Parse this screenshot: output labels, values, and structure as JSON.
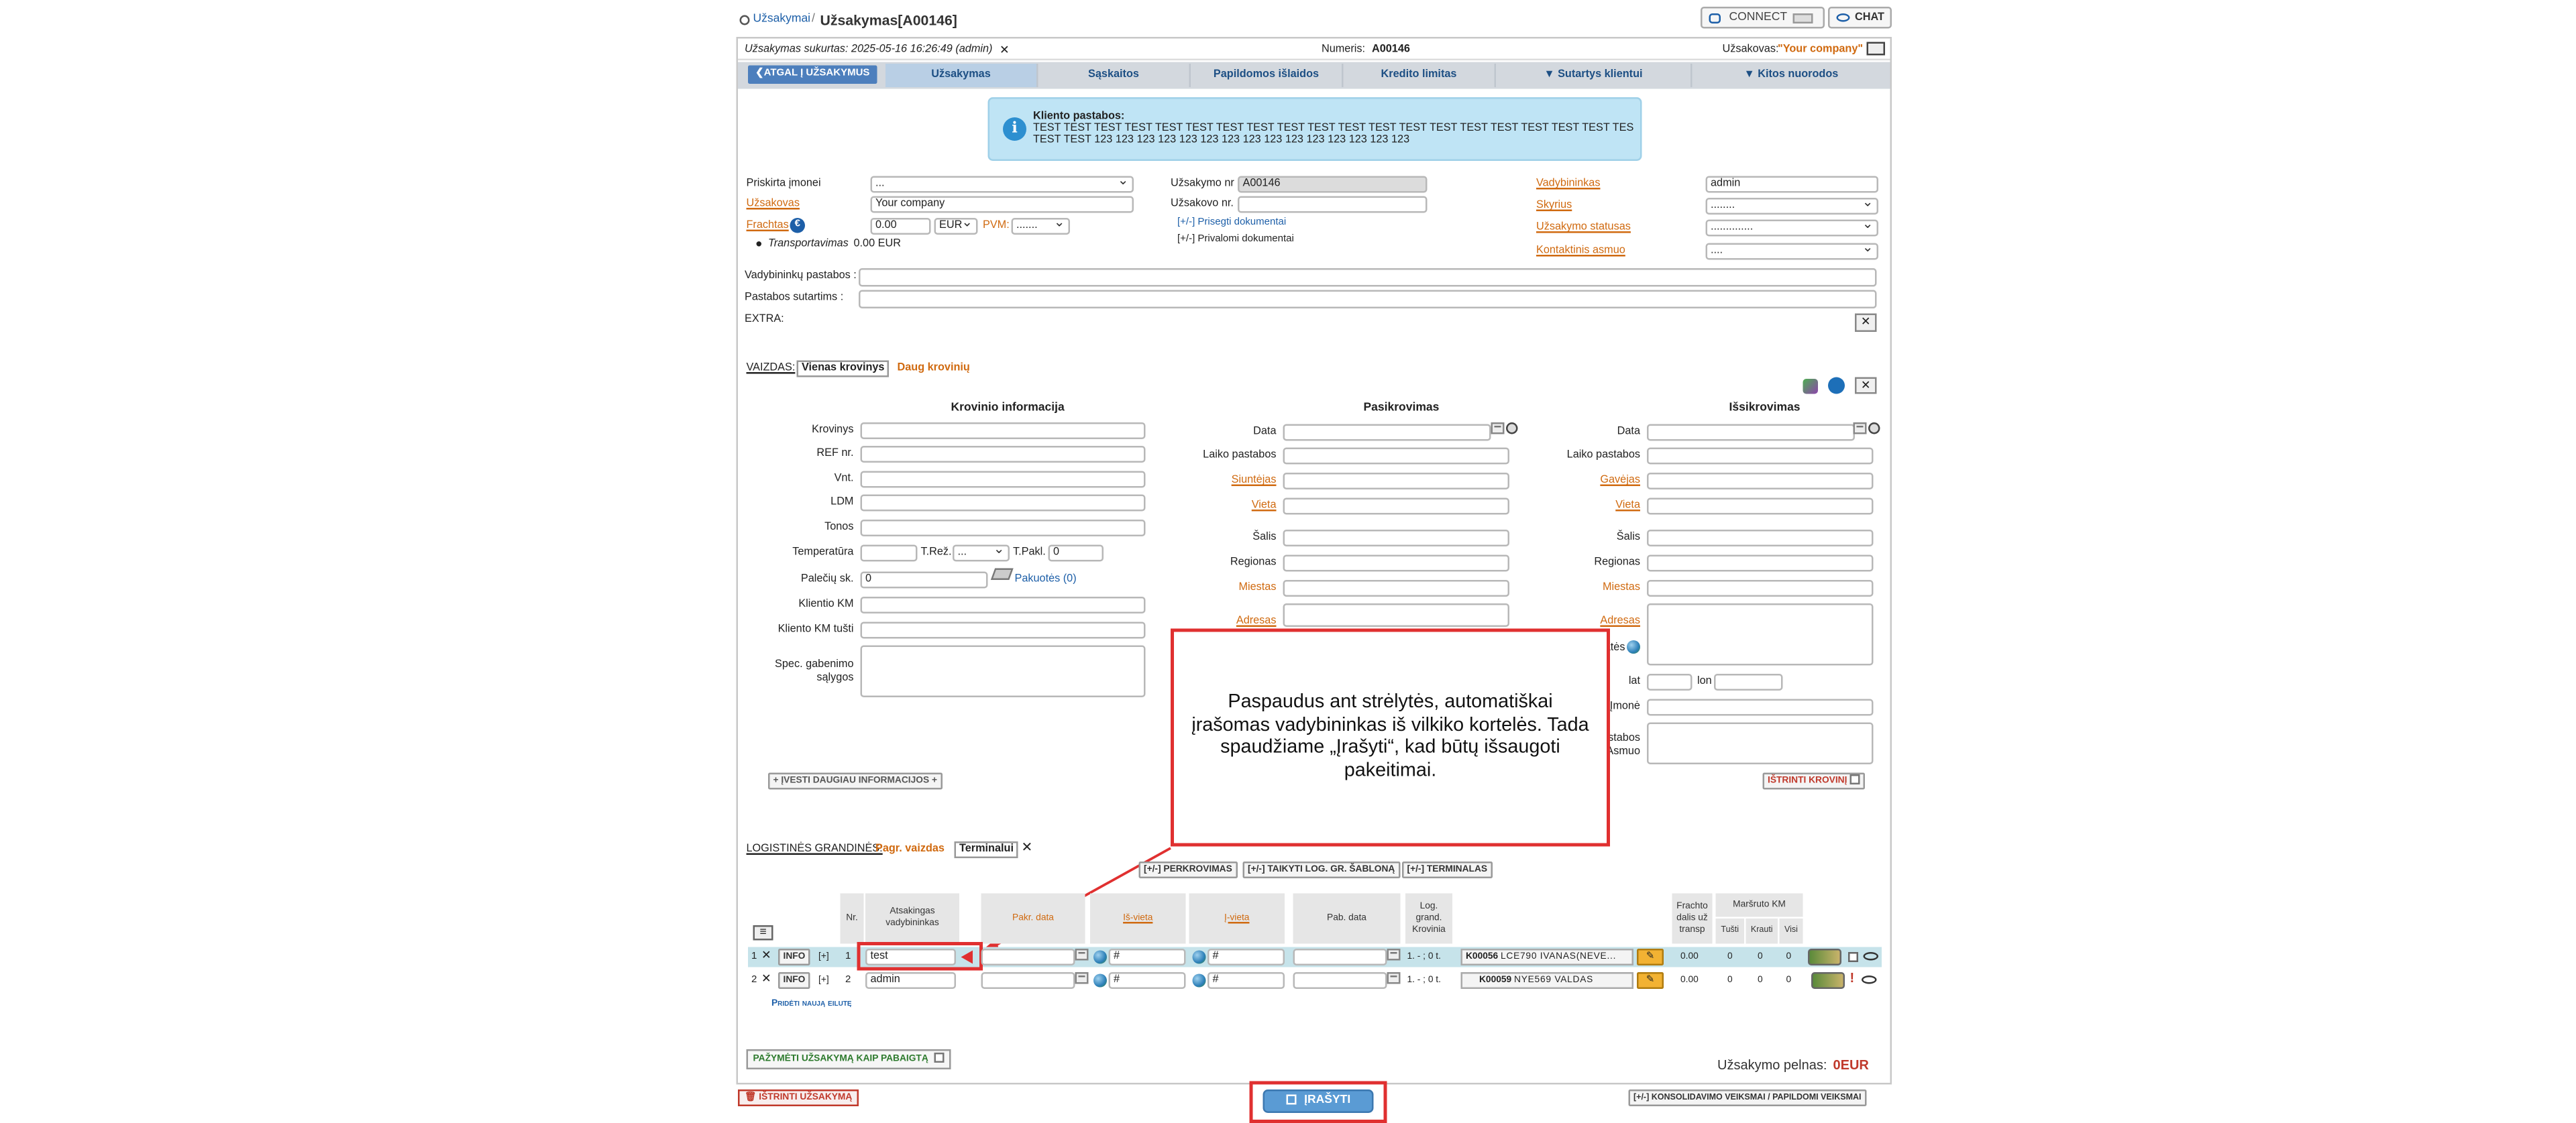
{
  "breadcrumb": {
    "parent": "Užsakymai",
    "separator": "/",
    "title": "Užsakymas[A00146]"
  },
  "top_buttons": {
    "connect": "CONNECT",
    "chat": "CHAT"
  },
  "infobar": {
    "created": "Užsakymas sukurtas: 2025-05-16 16:26:49 (admin)",
    "number_label": "Numeris:",
    "number": "A00146",
    "client_label": "Užsakovas:",
    "client": "\"Your company\""
  },
  "tabs": {
    "back": "❮ATGAL Į UŽSAKYMUS",
    "order": "Užsakymas",
    "accounts": "Sąskaitos",
    "extra_costs": "Papildomos išlaidos",
    "credit": "Kredito limitas",
    "contract": "▼ Sutartys klientui",
    "links": "▼ Kitos nuorodos"
  },
  "client_notes": {
    "title": "Kliento pastabos:",
    "line1": "TEST TEST TEST TEST TEST TEST TEST TEST TEST TEST TEST TEST TEST TEST TEST TEST TEST TEST TEST TEST",
    "line2": "TEST TEST 123 123 123 123 123 123 123 123 123 123 123 123 123 123 123"
  },
  "form": {
    "assigned_company_label": "Priskirta įmonei",
    "assigned_company_value": "...",
    "customer_label": "Užsakovas",
    "customer_value": "Your company",
    "freight_label": "Frachtas",
    "freight_value": "0.00",
    "currency": "EUR",
    "vat_label": "PVM:",
    "vat_value": ".......",
    "transport_label": "Transportavimas",
    "transport_value": "0.00 EUR",
    "order_nr_label": "Užsakymo nr",
    "order_nr_value": "A00146",
    "customer_nr_label": "Užsakovo nr. :",
    "customer_nr_value": "",
    "attach_docs": "[+/-] Prisegti dokumentai",
    "private_docs": "[+/-] Privalomi dokumentai",
    "manager_label": "Vadybininkas",
    "manager_value": "admin",
    "department_label": "Skyrius",
    "department_value": "........",
    "status_label": "Užsakymo statusas",
    "status_value": "..............",
    "contact_label": "Kontaktinis asmuo",
    "contact_value": "....",
    "manager_notes_label": "Vadybininkų pastabos :",
    "contract_notes_label": "Pastabos sutartims :",
    "extra_label": "EXTRA:"
  },
  "view": {
    "label": "VAIZDAS:",
    "single": "Vienas krovinys",
    "multi": "Daug krovinių"
  },
  "cargo": {
    "title": "Krovinio informacija",
    "cargo_label": "Krovinys",
    "ref_label": "REF nr.",
    "units_label": "Vnt.",
    "ldm_label": "LDM",
    "tons_label": "Tonos",
    "temp_label": "Temperatūra",
    "treg_label": "T.Rež.",
    "treg_value": "...",
    "tpakl_label": "T.Pakl.",
    "tpakl_value": "0",
    "pallets_label": "Palečių sk.",
    "pallets_value": "0",
    "packages": "Pakuotės (0)",
    "client_km_label": "Klientio KM",
    "client_km_empty_label": "Kliento KM tušti",
    "special_label": "Spec. gabenimo sąlygos",
    "more_info": "+ ĮVESTI DAUGIAU INFORMACIJOS +",
    "delete_cargo": "IŠTRINTI KROVINĮ"
  },
  "loading": {
    "title": "Pasikrovimas",
    "date_label": "Data",
    "time_notes_label": "Laiko pastabos",
    "sender_label": "Siuntėjas",
    "place_label": "Vieta",
    "country_label": "Šalis",
    "region_label": "Regionas",
    "city_label": "Miestas",
    "address_label": "Adresas"
  },
  "unloading": {
    "title": "Išsikrovimas",
    "date_label": "Data",
    "time_notes_label": "Laiko pastabos",
    "receiver_label": "Gavėjas",
    "place_label": "Vieta",
    "country_label": "Šalis",
    "region_label": "Regionas",
    "city_label": "Miestas",
    "address_label": "Adresas",
    "coords_label": "Koordinatės",
    "lat_label": "lat",
    "lon_label": "lon",
    "company_label": "Įmonė",
    "contact_label": "Pastabos / Asmuo"
  },
  "callout": {
    "text": "Paspaudus ant strėlytės, automatiškai įrašomas vadybininkas iš vilkiko kortelės. Tada spaudžiame „Įrašyti“, kad būtų išsaugoti pakeitimai."
  },
  "logistics": {
    "label": "LOGISTINĖS GRANDINĖS:",
    "main_view": "Pagr. vaizdas",
    "terminals": "Terminalui",
    "btn_transship": "[+/-] PERKROVIMAS",
    "btn_template": "[+/-] TAIKYTI LOG. GR. ŠABLONĄ",
    "btn_terminals": "[+/-] TERMINALAS",
    "headers": {
      "nr": "Nr.",
      "manager": "Atsakingas vadybininkas",
      "loading_date": "Pakr. data",
      "from": "Iš-vieta",
      "to": "Į-vieta",
      "unloading_date": "Pab. data",
      "chain": "Log. grand. Krovinia",
      "freight_part": "Frachto dalis už transp",
      "route_km": "Maršruto KM",
      "empty": "Tušti",
      "loaded": "Krauti",
      "total": "Visi"
    },
    "rows": [
      {
        "idx": "1",
        "info": "INFO",
        "plus": "[+]",
        "nr": "1",
        "manager": "test",
        "from": "#",
        "to": "#",
        "chain": "1. - ; 0 t.",
        "truck_code": "K00056",
        "truck": "LCE790 IVANAS(NEVE...",
        "freight": "0.00",
        "empty": "0",
        "loaded": "0",
        "total": "0"
      },
      {
        "idx": "2",
        "info": "INFO",
        "plus": "[+]",
        "nr": "2",
        "manager": "admin",
        "from": "#",
        "to": "#",
        "chain": "1. - ; 0 t.",
        "truck_code": "K00059",
        "truck": "NYE569 VALDAS",
        "freight": "0.00",
        "empty": "0",
        "loaded": "0",
        "total": "0"
      }
    ],
    "add_row": "Pridėti naują eilutę"
  },
  "footer": {
    "mark_done": "PAŽYMĖTI UŽSAKYMĄ KAIP PABAIGTĄ",
    "profit_label": "Užsakymo pelnas:",
    "profit_value": "0EUR",
    "delete_order": "IŠTRINTI UŽSAKYMĄ",
    "save": "ĮRAŠYTI",
    "consolidation": "[+/-] KONSOLIDAVIMO VEIKSMAI / PAPILDOMI VEIKSMAI"
  },
  "colors": {
    "accent": "#5a9bd4",
    "callout_border": "#e03030",
    "note_bg": "#bfe4f5",
    "orange": "#d06a10",
    "green_row": "#c6e3ea"
  }
}
